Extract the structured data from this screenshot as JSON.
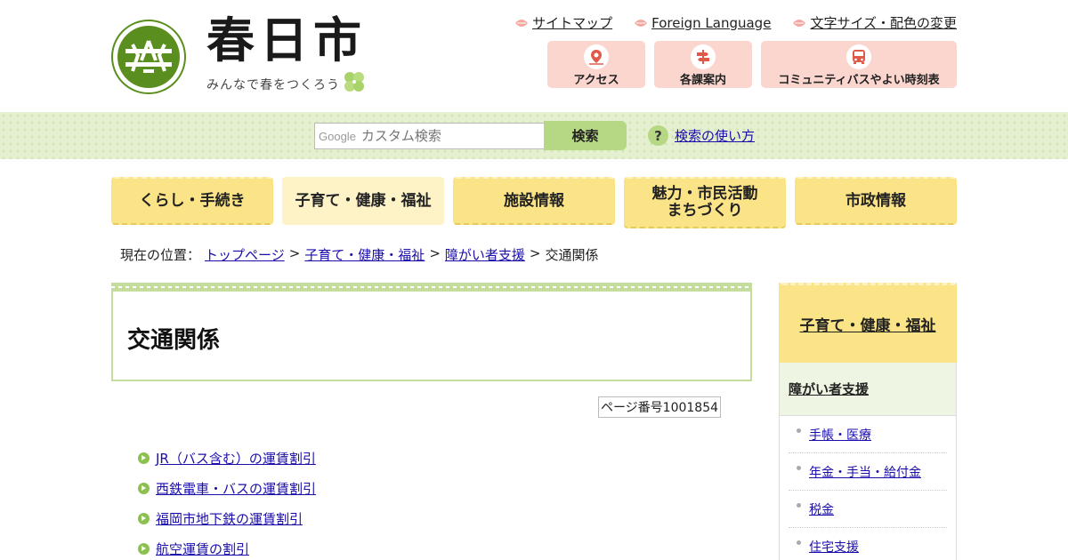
{
  "header": {
    "logo_title": "春日市",
    "logo_tagline": "みんなで春をつくろう",
    "top_links": [
      "サイトマップ",
      "Foreign Language",
      "文字サイズ・配色の変更"
    ],
    "quick_buttons": [
      "アクセス",
      "各課案内",
      "コミュニティバスやよい時刻表"
    ]
  },
  "search": {
    "google_label": "Google",
    "placeholder": "カスタム検索",
    "button_label": "検索",
    "help_link": "検索の使い方"
  },
  "global_nav": [
    "くらし・手続き",
    "子育て・健康・福祉",
    "施設情報",
    "魅力・市民活動\nまちづくり",
    "市政情報"
  ],
  "breadcrumb": {
    "prefix": "現在の位置：",
    "links": [
      "トップページ",
      "子育て・健康・福祉",
      "障がい者支援"
    ],
    "separator": ">",
    "current": "交通関係"
  },
  "main": {
    "title": "交通関係",
    "page_number": "ページ番号1001854",
    "links": [
      "JR（バス含む）の運賃割引",
      "西鉄電車・バスの運賃割引",
      "福岡市地下鉄の運賃割引",
      "航空運賃の割引"
    ]
  },
  "sidebar": {
    "heading": "子育て・健康・福祉",
    "subheading": "障がい者支援",
    "items": [
      "手帳・医療",
      "年金・手当・給付金",
      "税金",
      "住宅支援"
    ]
  },
  "colors": {
    "nav_yellow": "#fbe487",
    "nav_active": "#fdf3c7",
    "green_accent": "#b6d784",
    "quick_pink": "#fbd6cf",
    "link_blue": "#1a0dab"
  }
}
